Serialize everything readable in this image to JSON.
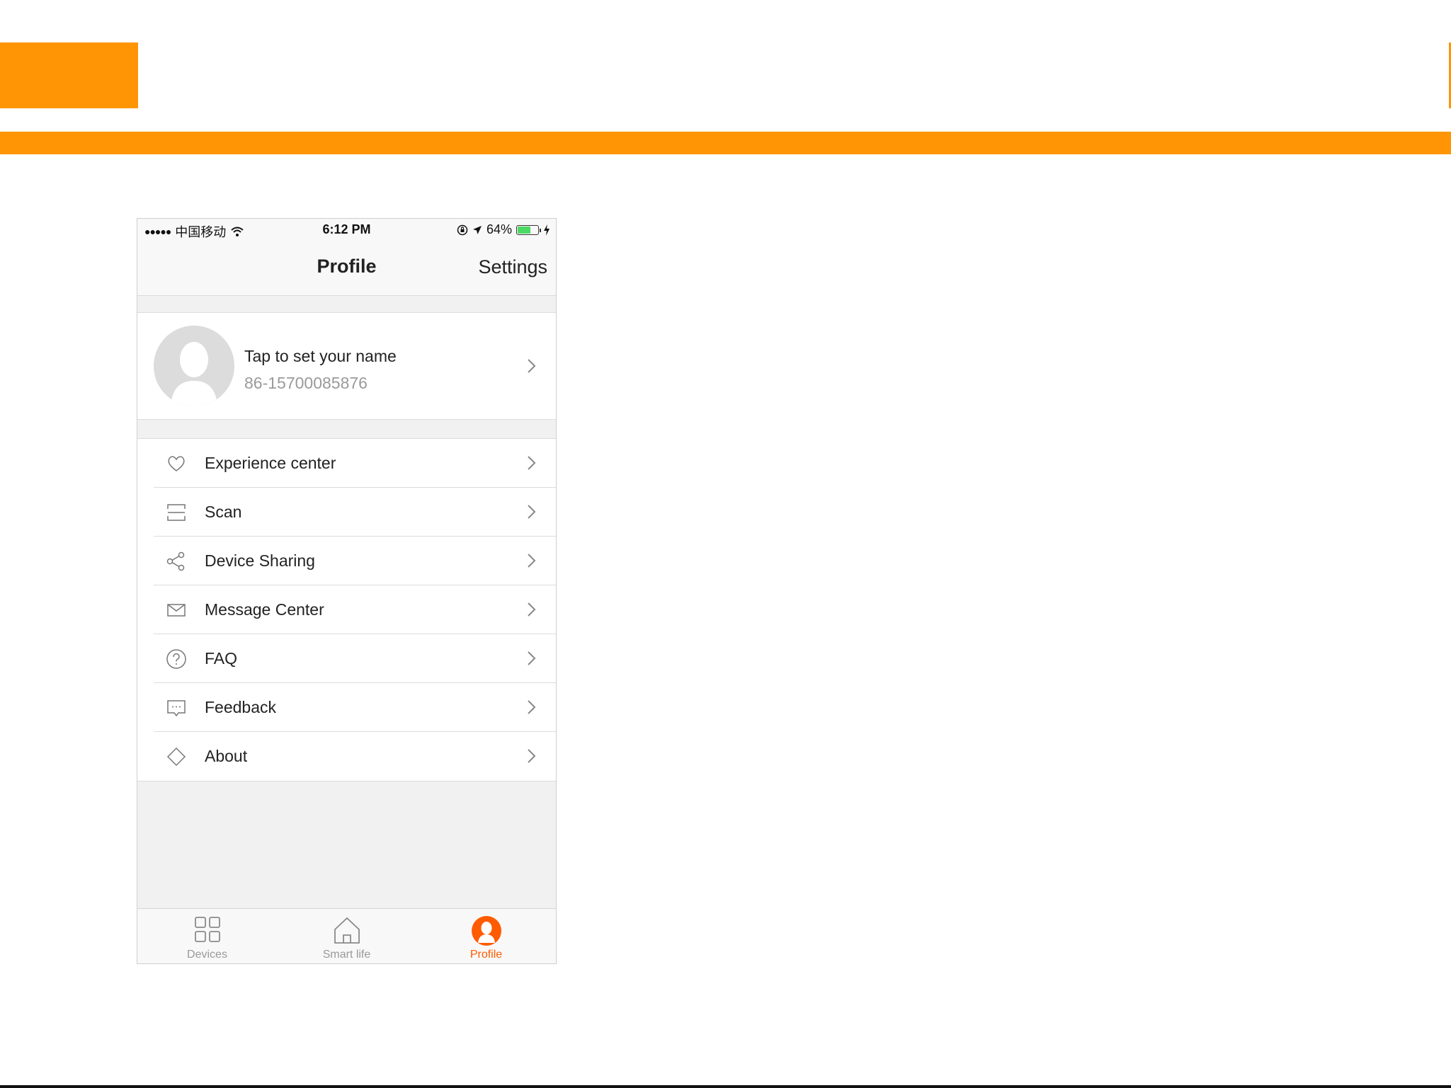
{
  "colors": {
    "accent": "#ff9505",
    "active_tab": "#ff5b00",
    "battery": "#4cd964"
  },
  "status_bar": {
    "signal_dots": "●●●●●",
    "carrier": "中国移动",
    "time": "6:12 PM",
    "battery_percent": "64%",
    "battery_level": 0.64
  },
  "nav": {
    "title": "Profile",
    "settings_label": "Settings"
  },
  "profile": {
    "name": "Tap to set your name",
    "phone": "86-15700085876"
  },
  "menu": {
    "items": [
      {
        "label": "Experience center",
        "icon": "heart-icon"
      },
      {
        "label": "Scan",
        "icon": "scan-icon"
      },
      {
        "label": "Device Sharing",
        "icon": "share-icon"
      },
      {
        "label": "Message Center",
        "icon": "mail-icon"
      },
      {
        "label": "FAQ",
        "icon": "question-icon"
      },
      {
        "label": "Feedback",
        "icon": "feedback-icon"
      },
      {
        "label": "About",
        "icon": "diamond-icon"
      }
    ]
  },
  "tabs": [
    {
      "label": "Devices",
      "icon": "grid-icon",
      "active": false
    },
    {
      "label": "Smart life",
      "icon": "home-icon",
      "active": false
    },
    {
      "label": "Profile",
      "icon": "person-icon",
      "active": true
    }
  ]
}
